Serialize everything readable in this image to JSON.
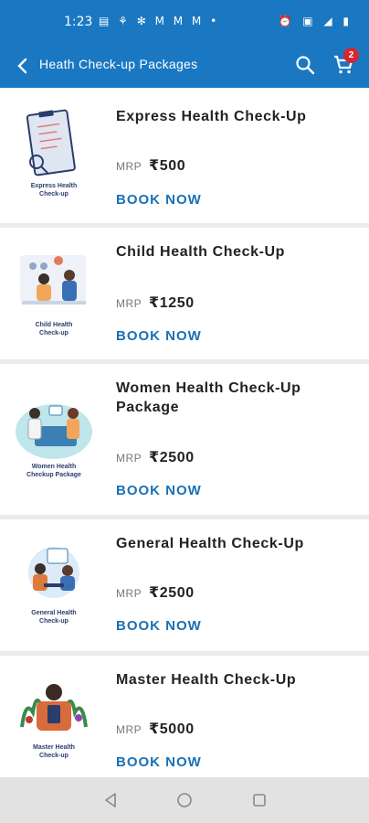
{
  "status": {
    "time": "1:23",
    "notif_icons": "▤ ⚘ ✻ M M M •",
    "sys_icons": "⏰ ▣ ◢ ▮"
  },
  "header": {
    "title": "Heath Check-up Packages",
    "cart_count": "2"
  },
  "packages": [
    {
      "name": "Express Health Check-Up",
      "mrp_label": "MRP",
      "price": "₹500",
      "action": "BOOK NOW",
      "thumb_caption": [
        "Express Health",
        "Check-up"
      ]
    },
    {
      "name": "Child Health Check-Up",
      "mrp_label": "MRP",
      "price": "₹1250",
      "action": "BOOK NOW",
      "thumb_caption": [
        "Child Health",
        "Check-up"
      ]
    },
    {
      "name": "Women Health Check-Up Package",
      "mrp_label": "MRP",
      "price": "₹2500",
      "action": "BOOK NOW",
      "thumb_caption": [
        "Women Health",
        "Checkup Package"
      ]
    },
    {
      "name": "General Health Check-Up",
      "mrp_label": "MRP",
      "price": "₹2500",
      "action": "BOOK NOW",
      "thumb_caption": [
        "General Health",
        "Check-up"
      ]
    },
    {
      "name": "Master Health Check-Up",
      "mrp_label": "MRP",
      "price": "₹5000",
      "action": "BOOK NOW",
      "thumb_caption": [
        "Master Health",
        "Check-up"
      ]
    }
  ],
  "colors": {
    "primary": "#1a78c2",
    "action": "#1a70b5",
    "badge": "#d7262f"
  }
}
